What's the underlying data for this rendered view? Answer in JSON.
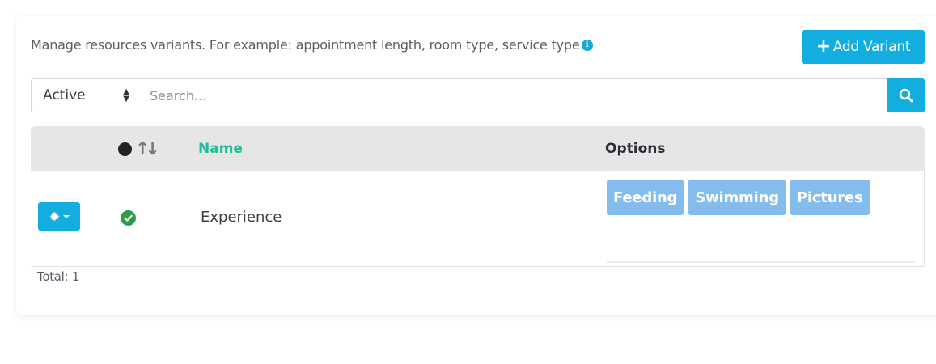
{
  "header": {
    "description": "Manage resources variants. For example: appointment length, room type, service type",
    "info_icon": "i",
    "add_button_label": "Add Variant"
  },
  "filters": {
    "status_selected": "Active",
    "search_placeholder": "Search..."
  },
  "table": {
    "columns": {
      "name": "Name",
      "options": "Options"
    },
    "rows": [
      {
        "status": "active",
        "name": "Experience",
        "options": [
          "Feeding",
          "Swimming",
          "Pictures"
        ]
      }
    ]
  },
  "footer": {
    "total": "Total: 1"
  },
  "colors": {
    "accent": "#13aee0",
    "tag": "#84bdec",
    "name_header": "#1bbf9a",
    "active_check": "#2a9d4a"
  }
}
